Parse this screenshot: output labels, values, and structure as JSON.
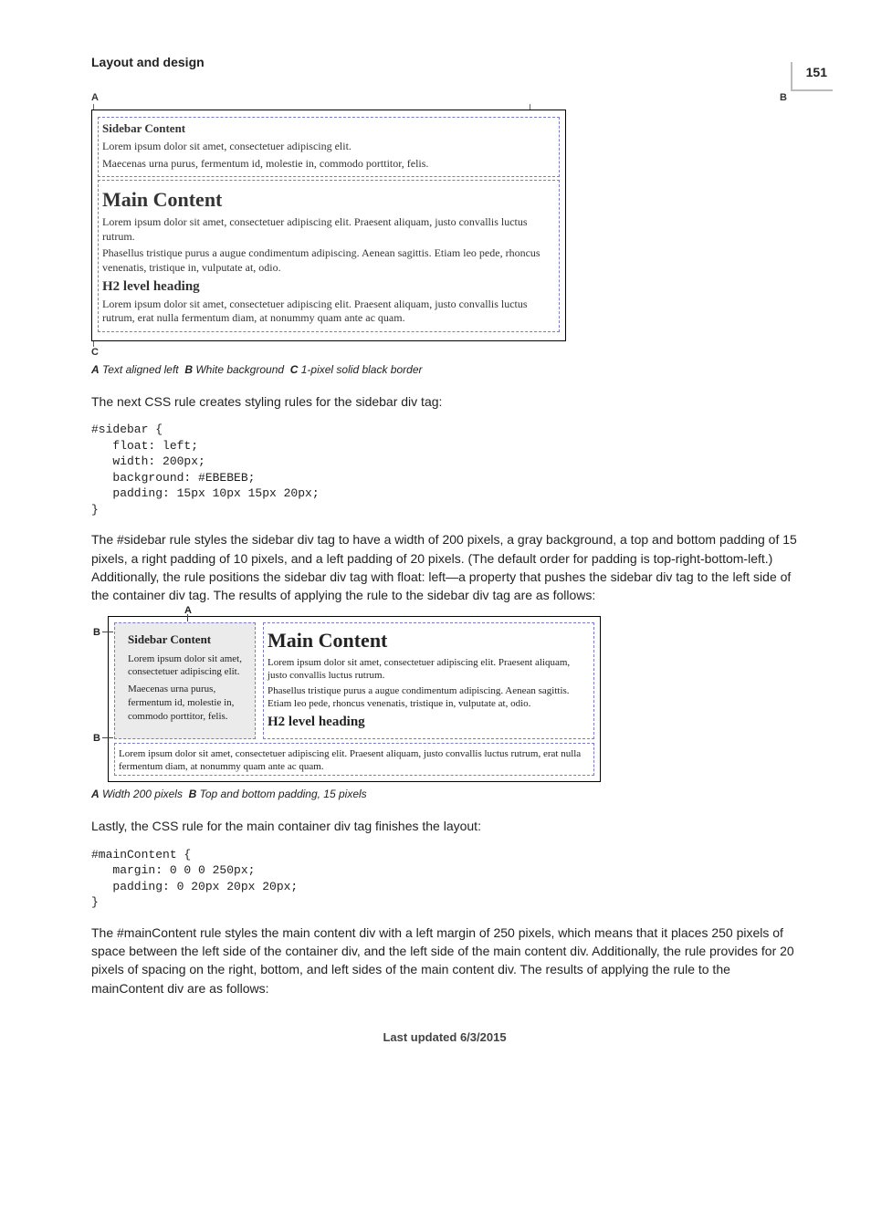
{
  "pageNumber": "151",
  "sectionTitle": "Layout and design",
  "fig1": {
    "labelA": "A",
    "labelB": "B",
    "labelC": "C",
    "sidebarHeading": "Sidebar Content",
    "sidebarP1": "Lorem ipsum dolor sit amet, consectetuer adipiscing elit.",
    "sidebarP2": "Maecenas urna purus, fermentum id, molestie in, commodo porttitor, felis.",
    "mainHeading": "Main Content",
    "mainP1": "Lorem ipsum dolor sit amet, consectetuer adipiscing elit. Praesent aliquam, justo convallis luctus rutrum.",
    "mainP2": "Phasellus tristique purus a augue condimentum adipiscing. Aenean sagittis. Etiam leo pede, rhoncus venenatis, tristique in, vulputate at, odio.",
    "h2Heading": "H2 level heading",
    "h2P": "Lorem ipsum dolor sit amet, consectetuer adipiscing elit. Praesent aliquam, justo convallis luctus rutrum, erat nulla fermentum diam, at nonummy quam ante ac quam."
  },
  "caption1": {
    "a": "A",
    "aText": "Text aligned left",
    "b": "B",
    "bText": "White background",
    "c": "C",
    "cText": "1-pixel solid black border"
  },
  "para1": "The next CSS rule creates styling rules for the sidebar div tag:",
  "code1": "#sidebar {\n   float: left;\n   width: 200px;\n   background: #EBEBEB;\n   padding: 15px 10px 15px 20px;\n}",
  "para2": "The #sidebar rule styles the sidebar div tag to have a width of 200 pixels, a gray background, a top and bottom padding of 15 pixels, a right padding of 10 pixels, and a left padding of 20 pixels. (The default order for padding is top-right-bottom-left.) Additionally, the rule positions the sidebar div tag with float: left—a property that pushes the sidebar div tag to the left side of the container div tag. The results of applying the rule to the sidebar div tag are as follows:",
  "fig2": {
    "labelA": "A",
    "labelB": "B",
    "sidebarHeading": "Sidebar Content",
    "sidebarP1": "Lorem ipsum dolor sit amet, consectetuer adipiscing elit.",
    "sidebarP2": "Maecenas urna purus, fermentum id, molestie in, commodo porttitor, felis.",
    "mainHeading": "Main Content",
    "mainP1": "Lorem ipsum dolor sit amet, consectetuer adipiscing elit. Praesent aliquam, justo convallis luctus rutrum.",
    "mainP2": "Phasellus tristique purus a augue condimentum adipiscing. Aenean sagittis. Etiam leo pede, rhoncus venenatis, tristique in, vulputate at, odio.",
    "h2Heading": "H2 level heading",
    "bottomP": "Lorem ipsum dolor sit amet, consectetuer adipiscing elit. Praesent aliquam, justo convallis luctus rutrum, erat nulla fermentum diam, at nonummy quam ante ac quam."
  },
  "caption2": {
    "a": "A",
    "aText": "Width 200 pixels",
    "b": "B",
    "bText": "Top and bottom padding, 15 pixels"
  },
  "para3": "Lastly, the CSS rule for the main container div tag finishes the layout:",
  "code2": "#mainContent {\n   margin: 0 0 0 250px;\n   padding: 0 20px 20px 20px;\n}",
  "para4": "The #mainContent rule styles the main content div with a left margin of 250 pixels, which means that it places 250 pixels of space between the left side of the container div, and the left side of the main content div. Additionally, the rule provides for 20 pixels of spacing on the right, bottom, and left sides of the main content div. The results of applying the rule to the mainContent div are as follows:",
  "footer": "Last updated 6/3/2015"
}
